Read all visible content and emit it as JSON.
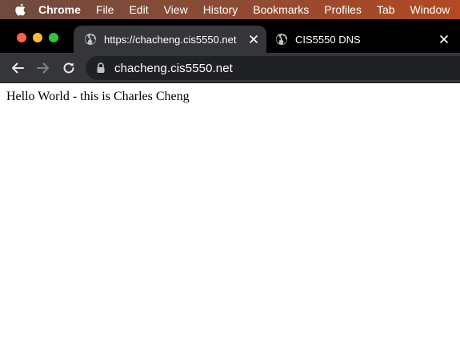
{
  "menubar": {
    "apple_icon": "apple-logo-icon",
    "items": [
      "Chrome",
      "File",
      "Edit",
      "View",
      "History",
      "Bookmarks",
      "Profiles",
      "Tab",
      "Window"
    ]
  },
  "tabs": [
    {
      "title": "https://chacheng.cis5550.net",
      "icon": "globe-icon",
      "active": true
    },
    {
      "title": "CIS5550 DNS",
      "icon": "globe-icon",
      "active": false
    }
  ],
  "toolbar": {
    "back_icon": "back-arrow-icon",
    "forward_icon": "forward-arrow-icon",
    "reload_icon": "reload-icon",
    "lock_icon": "lock-icon",
    "url": "chacheng.cis5550.net"
  },
  "page": {
    "text": "Hello World - this is Charles Cheng"
  },
  "colors": {
    "menubar_start": "#6e4a3f",
    "menubar_end": "#b24a22",
    "tabstrip": "#000000",
    "active_tab": "#35363a",
    "omnibox": "#202124",
    "close_red": "#ff5f57",
    "minimize_yellow": "#febc2e",
    "zoom_green": "#28c840"
  }
}
